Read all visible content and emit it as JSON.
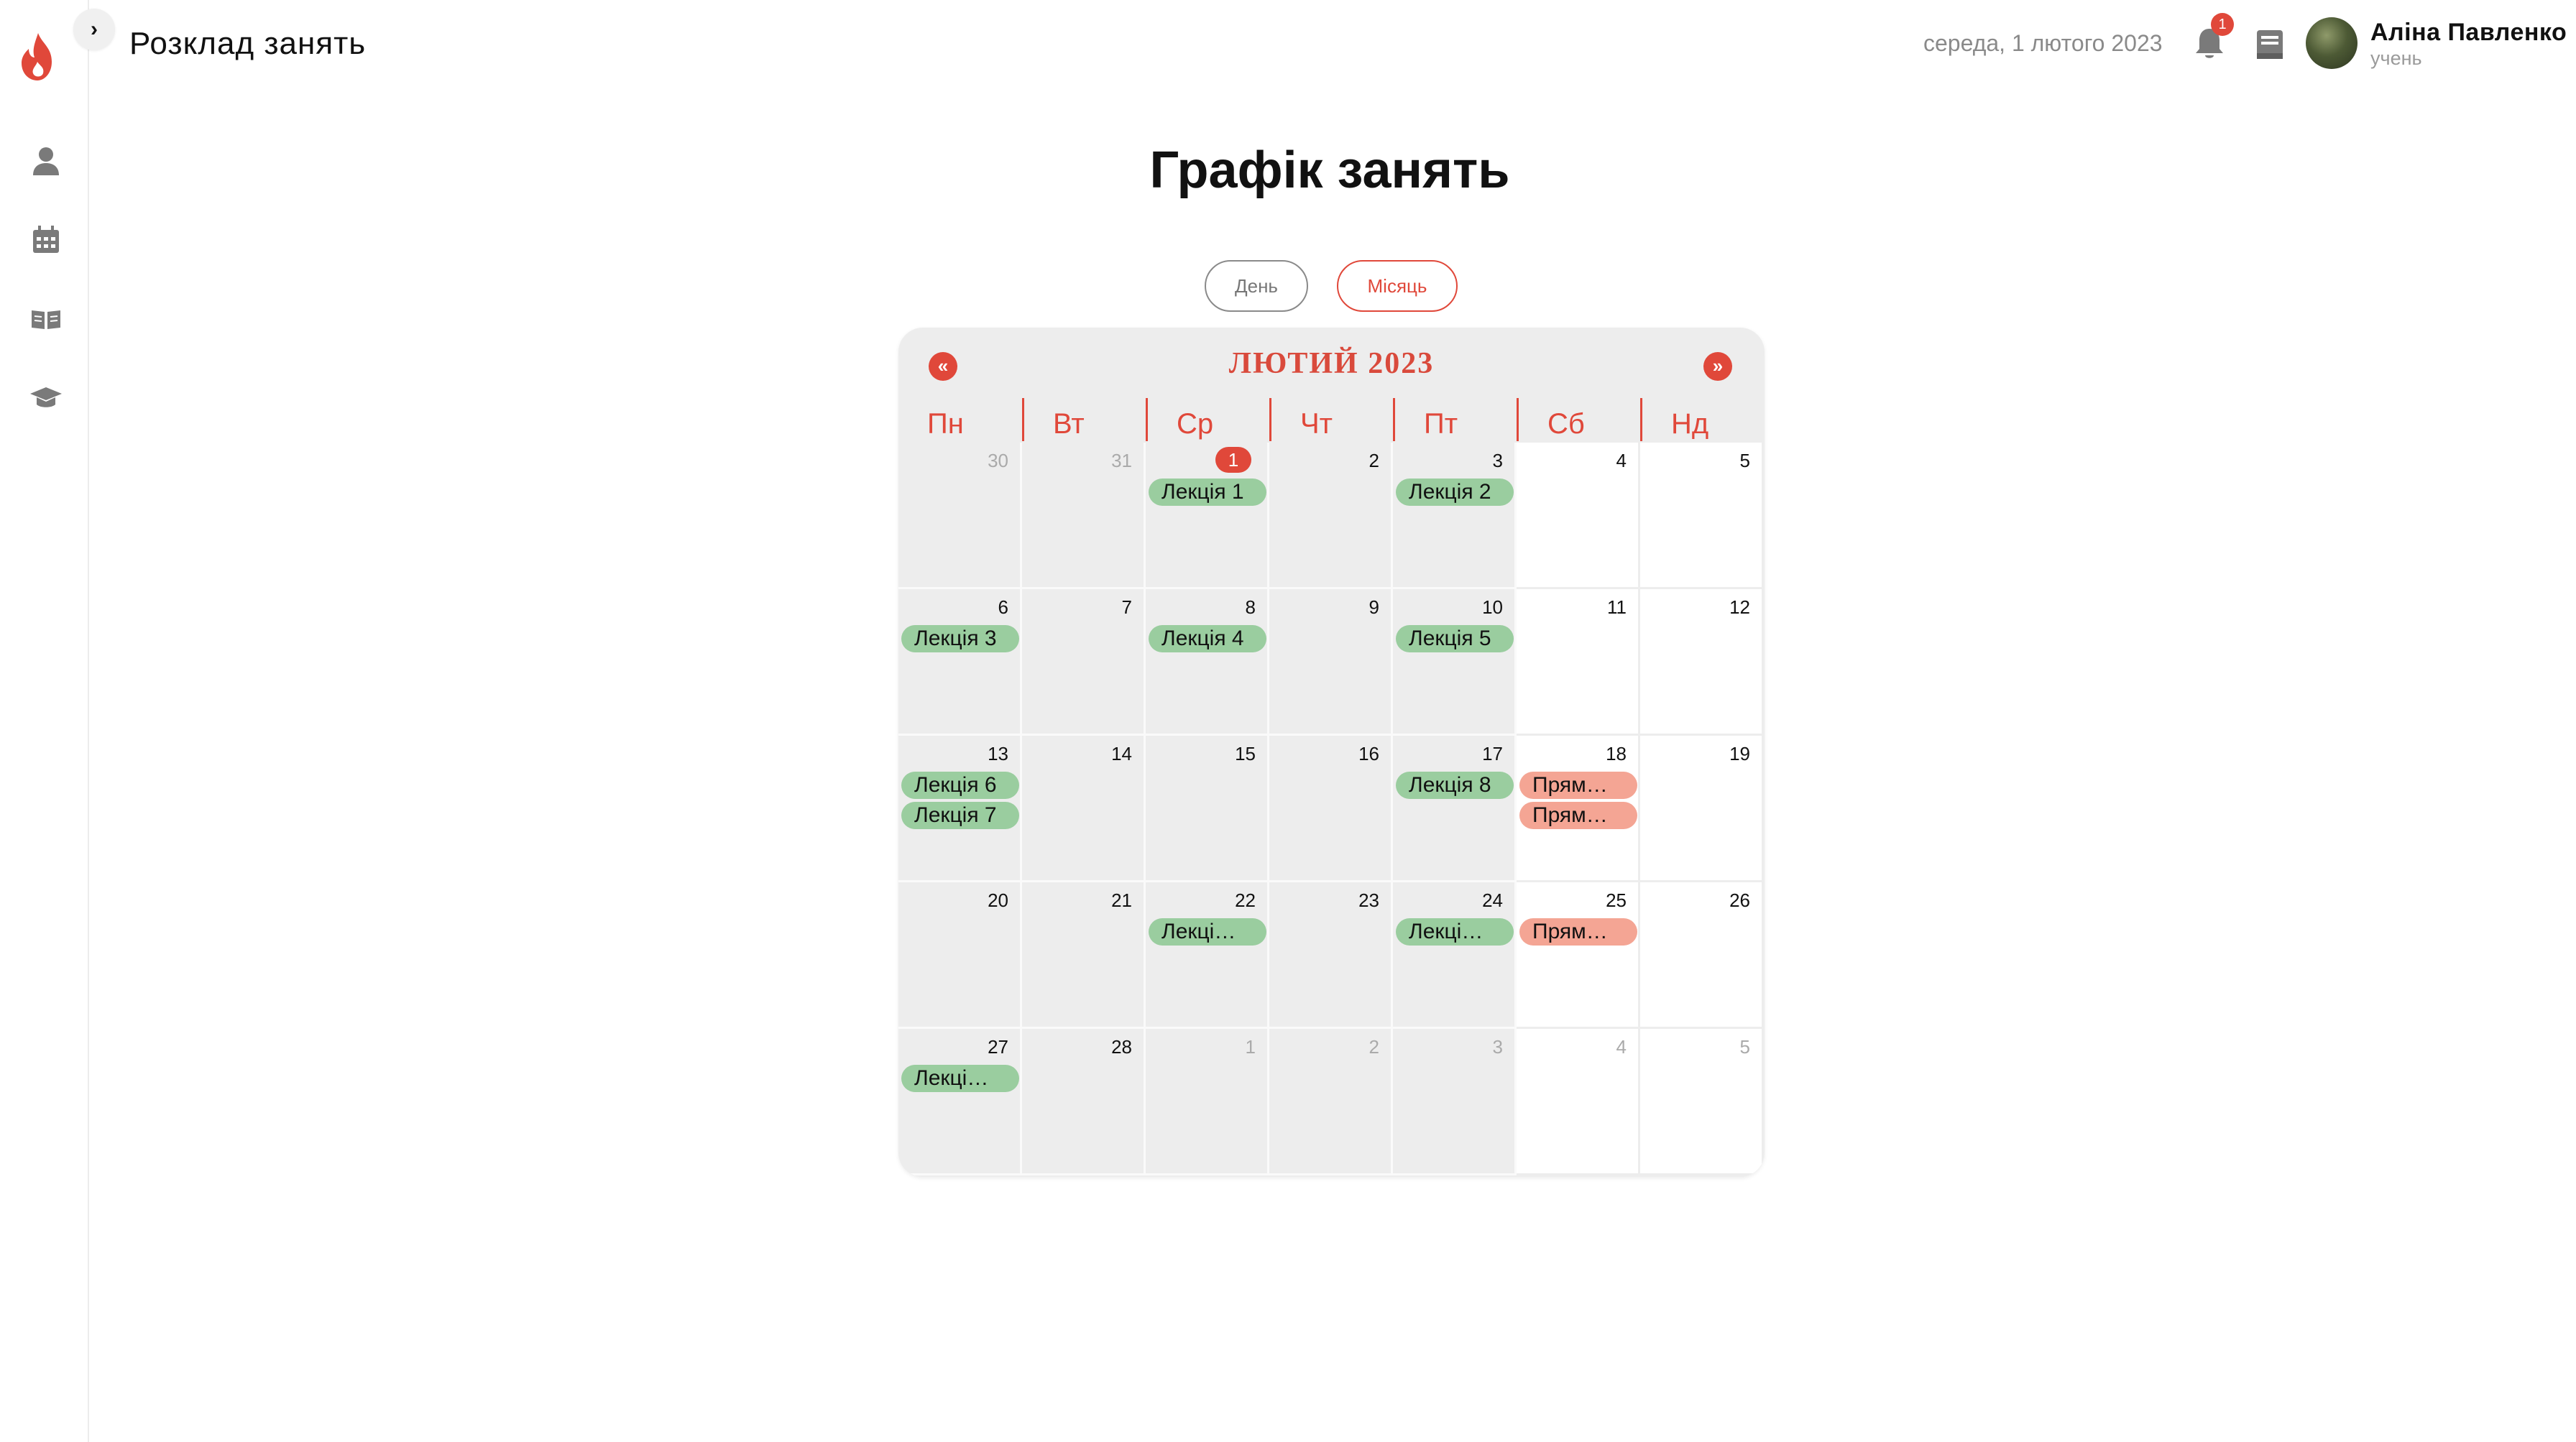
{
  "header": {
    "app_title": "Розклад занять",
    "date": "середа, 1 лютого 2023",
    "notification_count": "1",
    "user_name": "Аліна Павленко",
    "user_role": "учень"
  },
  "sidebar": {
    "items": [
      {
        "icon": "user-icon"
      },
      {
        "icon": "calendar-icon"
      },
      {
        "icon": "book-open-icon"
      },
      {
        "icon": "graduation-cap-icon"
      }
    ]
  },
  "page": {
    "title": "Графік занять",
    "view_day": "День",
    "view_month": "Місяць"
  },
  "calendar": {
    "month_title": "ЛЮТИЙ 2023",
    "prev": "«",
    "next": "»",
    "weekdays": [
      "Пн",
      "Вт",
      "Ср",
      "Чт",
      "Пт",
      "Сб",
      "Нд"
    ],
    "weeks": [
      [
        {
          "day": "30",
          "muted": true,
          "events": []
        },
        {
          "day": "31",
          "muted": true,
          "events": []
        },
        {
          "day": "1",
          "today": true,
          "events": [
            {
              "label": "Лекція 1",
              "kind": "lecture"
            }
          ]
        },
        {
          "day": "2",
          "events": []
        },
        {
          "day": "3",
          "events": [
            {
              "label": "Лекція 2",
              "kind": "lecture"
            }
          ]
        },
        {
          "day": "4",
          "events": []
        },
        {
          "day": "5",
          "events": []
        }
      ],
      [
        {
          "day": "6",
          "events": [
            {
              "label": "Лекція 3",
              "kind": "lecture"
            }
          ]
        },
        {
          "day": "7",
          "events": []
        },
        {
          "day": "8",
          "events": [
            {
              "label": "Лекція 4",
              "kind": "lecture"
            }
          ]
        },
        {
          "day": "9",
          "events": []
        },
        {
          "day": "10",
          "events": [
            {
              "label": "Лекція 5",
              "kind": "lecture"
            }
          ]
        },
        {
          "day": "11",
          "events": []
        },
        {
          "day": "12",
          "events": []
        }
      ],
      [
        {
          "day": "13",
          "events": [
            {
              "label": "Лекція 6",
              "kind": "lecture"
            },
            {
              "label": "Лекція 7",
              "kind": "lecture"
            }
          ]
        },
        {
          "day": "14",
          "events": []
        },
        {
          "day": "15",
          "events": []
        },
        {
          "day": "16",
          "events": []
        },
        {
          "day": "17",
          "events": [
            {
              "label": "Лекція 8",
              "kind": "lecture"
            }
          ]
        },
        {
          "day": "18",
          "events": [
            {
              "label": "Прям…",
              "kind": "practice"
            },
            {
              "label": "Прям…",
              "kind": "practice"
            }
          ]
        },
        {
          "day": "19",
          "events": []
        }
      ],
      [
        {
          "day": "20",
          "events": []
        },
        {
          "day": "21",
          "events": []
        },
        {
          "day": "22",
          "events": [
            {
              "label": "Лекці…",
              "kind": "lecture"
            }
          ]
        },
        {
          "day": "23",
          "events": []
        },
        {
          "day": "24",
          "events": [
            {
              "label": "Лекці…",
              "kind": "lecture"
            }
          ]
        },
        {
          "day": "25",
          "events": [
            {
              "label": "Прям…",
              "kind": "practice"
            }
          ]
        },
        {
          "day": "26",
          "events": []
        }
      ],
      [
        {
          "day": "27",
          "events": [
            {
              "label": "Лекці…",
              "kind": "lecture"
            }
          ]
        },
        {
          "day": "28",
          "events": []
        },
        {
          "day": "1",
          "muted": true,
          "events": []
        },
        {
          "day": "2",
          "muted": true,
          "events": []
        },
        {
          "day": "3",
          "muted": true,
          "events": []
        },
        {
          "day": "4",
          "muted": true,
          "events": []
        },
        {
          "day": "5",
          "muted": true,
          "events": []
        }
      ]
    ]
  },
  "colors": {
    "accent": "#e0483a",
    "lecture": "#9acd9f",
    "practice": "#f4a594",
    "cell_bg": "#ededed"
  }
}
